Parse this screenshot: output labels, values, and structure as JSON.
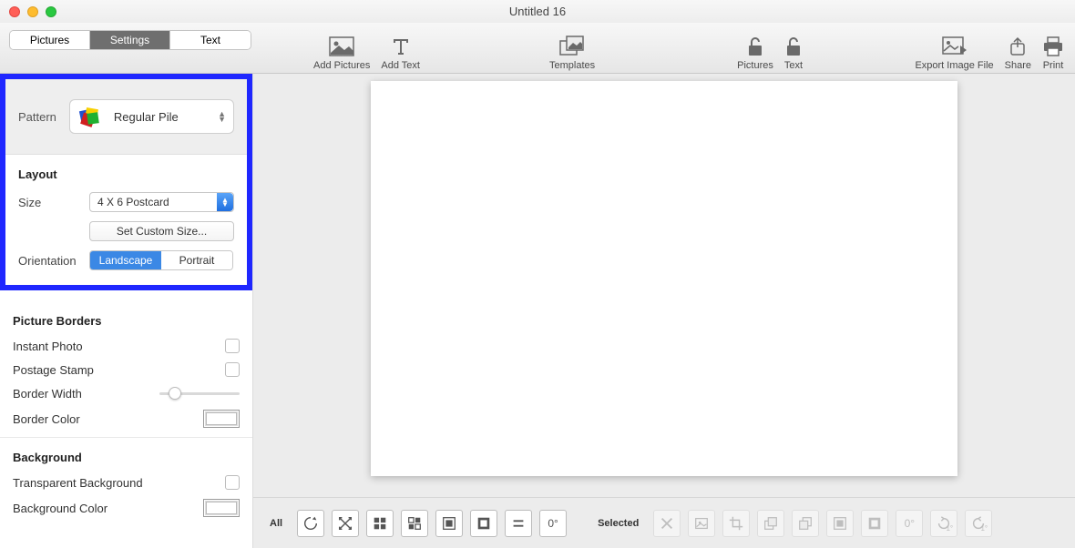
{
  "window": {
    "title": "Untitled 16"
  },
  "tabs": {
    "pictures": "Pictures",
    "settings": "Settings",
    "text": "Text",
    "active": "settings"
  },
  "toolbar": {
    "add_pictures": "Add Pictures",
    "add_text": "Add Text",
    "templates": "Templates",
    "lock_pictures": "Pictures",
    "lock_text": "Text",
    "export": "Export Image File",
    "share": "Share",
    "print": "Print"
  },
  "sidebar": {
    "pattern": {
      "label": "Pattern",
      "value": "Regular Pile"
    },
    "layout": {
      "heading": "Layout",
      "size_label": "Size",
      "size_value": "4 X 6 Postcard",
      "custom_btn": "Set Custom Size...",
      "orientation_label": "Orientation",
      "landscape": "Landscape",
      "portrait": "Portrait"
    },
    "borders": {
      "heading": "Picture Borders",
      "instant": "Instant Photo",
      "postage": "Postage Stamp",
      "width": "Border Width",
      "color": "Border Color"
    },
    "background": {
      "heading": "Background",
      "transparent": "Transparent Background",
      "color": "Background Color"
    }
  },
  "bottom": {
    "all_label": "All",
    "selected_label": "Selected",
    "zero_deg": "0°",
    "one_deg": "1°"
  }
}
